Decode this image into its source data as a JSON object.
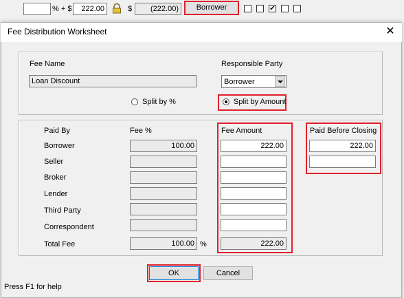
{
  "background": {
    "pct_symbol_label": "% + $",
    "amount_value": "222.00",
    "dollar_label": "$",
    "paid_value": "(222.00)",
    "borrower_button": "Borrower",
    "checkbox_check": "✔"
  },
  "dialog": {
    "title": "Fee Distribution Worksheet",
    "close_glyph": "✕",
    "fee_name_label": "Fee Name",
    "fee_name_value": "Loan Discount",
    "responsible_party_label": "Responsible Party",
    "responsible_party_value": "Borrower",
    "split_by_percent_label": "Split by %",
    "split_by_amount_label": "Split by Amount",
    "columns": {
      "paid_by": "Paid By",
      "fee_percent": "Fee %",
      "fee_amount": "Fee Amount",
      "paid_before_closing": "Paid Before Closing"
    },
    "rows": [
      {
        "label": "Borrower",
        "fee_percent": "100.00",
        "fee_amount": "222.00",
        "pbc": "222.00"
      },
      {
        "label": "Seller",
        "fee_percent": "",
        "fee_amount": "",
        "pbc": ""
      },
      {
        "label": "Broker",
        "fee_percent": "",
        "fee_amount": ""
      },
      {
        "label": "Lender",
        "fee_percent": "",
        "fee_amount": ""
      },
      {
        "label": "Third Party",
        "fee_percent": "",
        "fee_amount": ""
      },
      {
        "label": "Correspondent",
        "fee_percent": "",
        "fee_amount": ""
      }
    ],
    "total_label": "Total Fee",
    "total_percent": "100.00",
    "percent_symbol": "%",
    "total_amount": "222.00",
    "ok_label": "OK",
    "cancel_label": "Cancel",
    "status_text": "Press F1 for help"
  },
  "colors": {
    "highlight_red": "#e0202c",
    "window_bg": "#f0f0f0"
  }
}
